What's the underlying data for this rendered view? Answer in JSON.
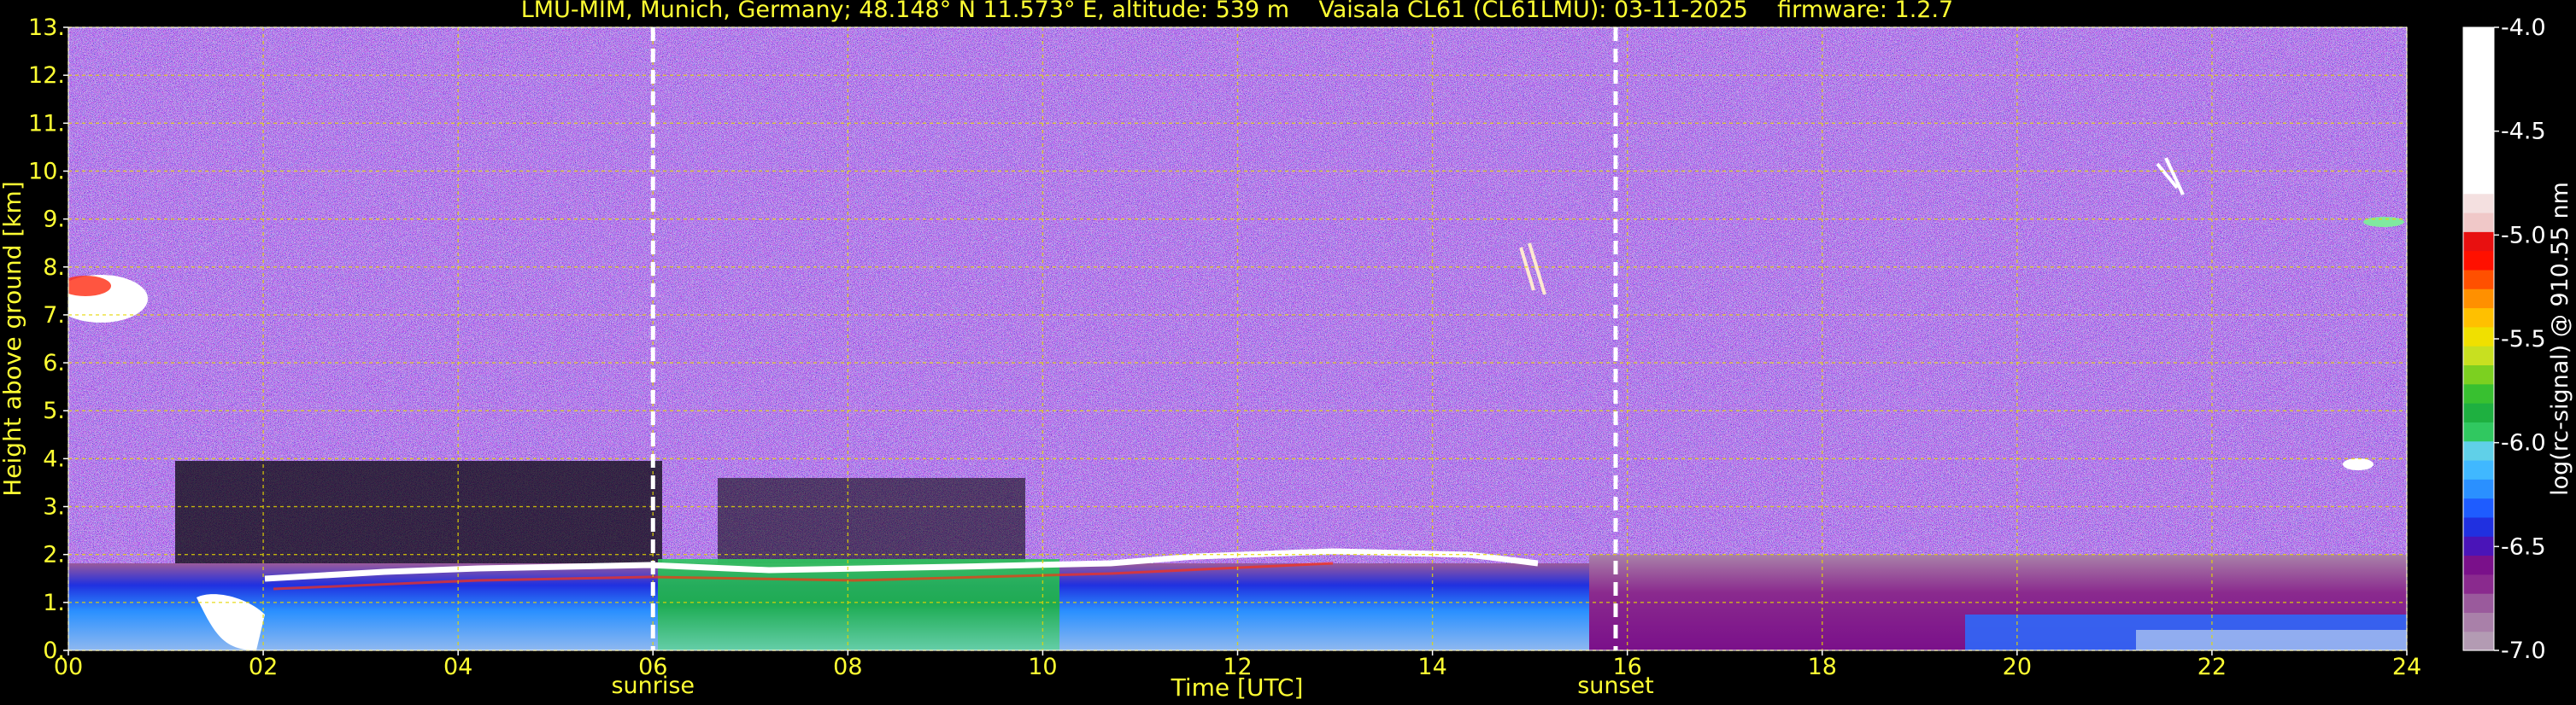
{
  "header": {
    "title": "LMU-MIM, Munich, Germany; 48.148° N 11.573° E, altitude: 539 m    Vaisala CL61 (CL61LMU): 03-11-2025    firmware: 1.2.7"
  },
  "colors": {
    "background": "#000000",
    "axis_text": "#ffff33",
    "grid": "#e6d800",
    "marker_lines": "#ffffff"
  },
  "chart_data": {
    "type": "heatmap",
    "title": "LMU-MIM, Munich, Germany; 48.148° N 11.573° E, altitude: 539 m    Vaisala CL61 (CL61LMU): 03-11-2025    firmware: 1.2.7",
    "xlabel": "Time [UTC]",
    "ylabel": "Height above ground [km]",
    "xlim": [
      0,
      24
    ],
    "ylim": [
      0,
      13
    ],
    "x_ticks": [
      0,
      2,
      4,
      6,
      8,
      10,
      12,
      14,
      16,
      18,
      20,
      22,
      24
    ],
    "x_tick_labels": [
      "00",
      "02",
      "04",
      "06",
      "08",
      "10",
      "12",
      "14",
      "16",
      "18",
      "20",
      "22",
      "24"
    ],
    "y_ticks": [
      0,
      1,
      2,
      3,
      4,
      5,
      6,
      7,
      8,
      9,
      10,
      11,
      12,
      13
    ],
    "y_tick_labels": [
      "0.",
      "1.",
      "2.",
      "3.",
      "4.",
      "5.",
      "6.",
      "7.",
      "8.",
      "9.",
      "10.",
      "11.",
      "12.",
      "13."
    ],
    "grid": true,
    "annotations": [
      {
        "label": "sunrise",
        "x": 6.0
      },
      {
        "label": "sunset",
        "x": 15.88
      }
    ],
    "colorbar": {
      "label": "log(rc-signal) @ 910.55 nm",
      "min": -7.0,
      "max": -4.0,
      "ticks": [
        -7.0,
        -6.5,
        -6.0,
        -5.5,
        -5.0,
        -4.5,
        -4.0
      ],
      "tick_labels": [
        "-7.0",
        "-6.5",
        "-6.0",
        "-5.5",
        "-5.0",
        "-4.5",
        "-4.0"
      ],
      "colors": [
        "#b39bb3",
        "#a980a9",
        "#9a5a9c",
        "#8a2a8e",
        "#7a108a",
        "#4a14b8",
        "#2030e0",
        "#1e5cff",
        "#2a90ff",
        "#40b8ff",
        "#60d0e8",
        "#30c860",
        "#1eb040",
        "#38c030",
        "#7cd020",
        "#c8e020",
        "#f0e000",
        "#ffc000",
        "#ff9000",
        "#ff5000",
        "#ff1000",
        "#e81010",
        "#f0c8c8",
        "#f4e0e0",
        "#ffffff"
      ]
    }
  }
}
